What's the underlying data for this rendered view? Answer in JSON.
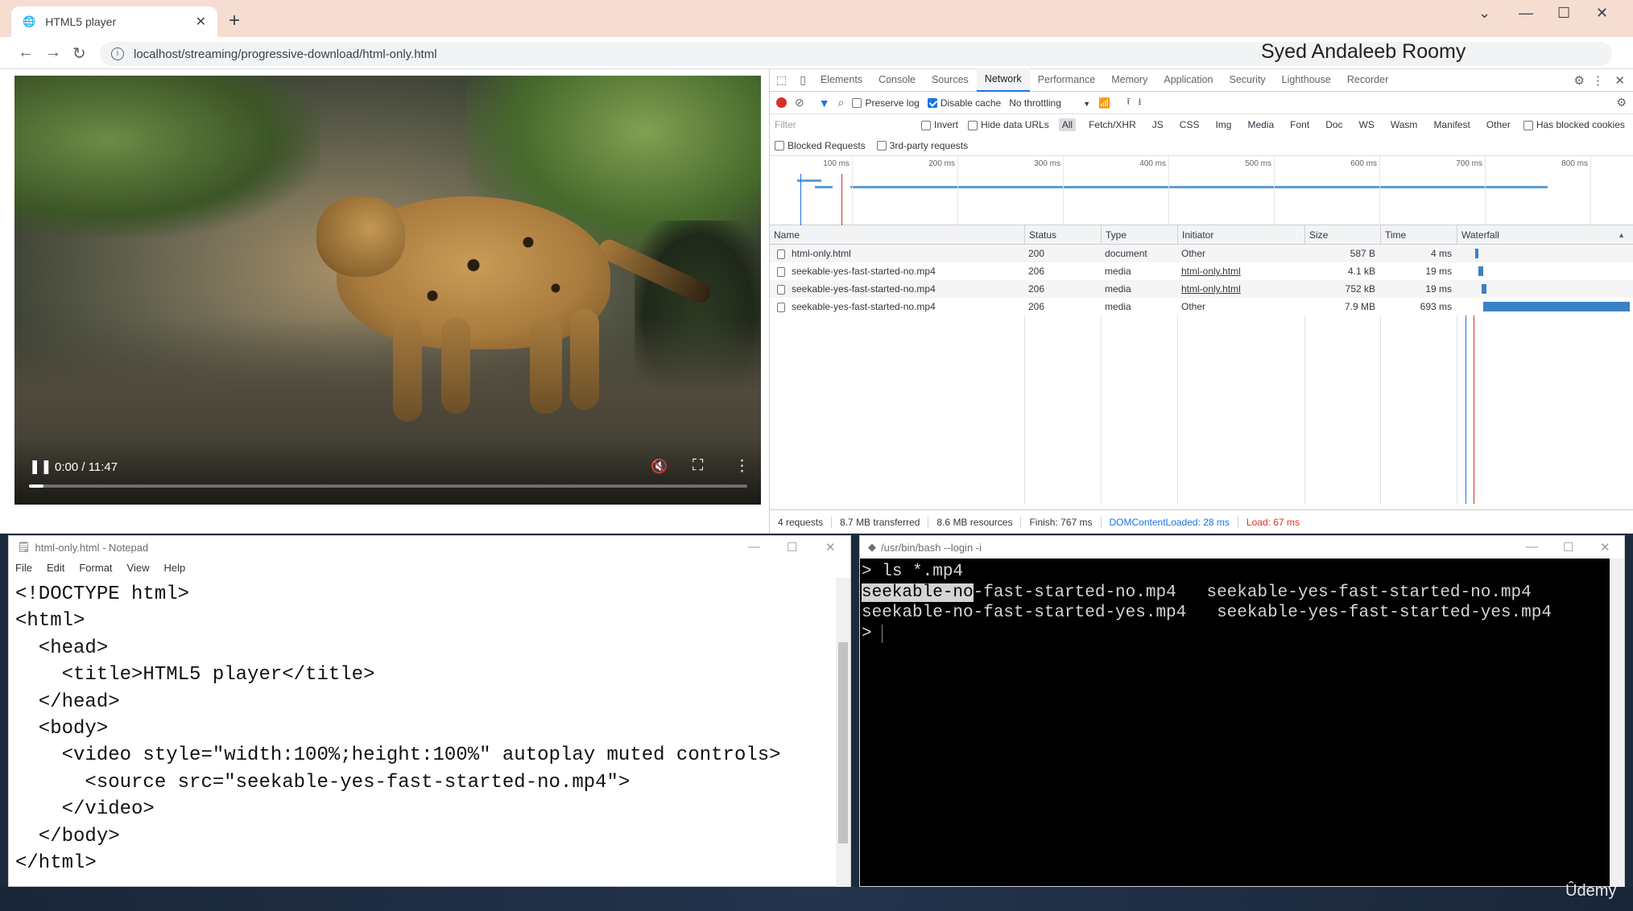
{
  "browser": {
    "tab_title": "HTML5 player",
    "url": "localhost/streaming/progressive-download/html-only.html",
    "watermark": "Syed Andaleeb Roomy"
  },
  "video": {
    "time": "0:00 / 11:47",
    "progress": 0.02
  },
  "devtools": {
    "tabs": [
      "Elements",
      "Console",
      "Sources",
      "Network",
      "Performance",
      "Memory",
      "Application",
      "Security",
      "Lighthouse",
      "Recorder"
    ],
    "active_tab": "Network",
    "toolbar": {
      "preserve_log": "Preserve log",
      "disable_cache": "Disable cache",
      "throttling": "No throttling"
    },
    "filter": {
      "placeholder": "Filter",
      "invert": "Invert",
      "hide_data_urls": "Hide data URLs",
      "types": [
        "All",
        "Fetch/XHR",
        "JS",
        "CSS",
        "Img",
        "Media",
        "Font",
        "Doc",
        "WS",
        "Wasm",
        "Manifest",
        "Other"
      ],
      "has_blocked_cookies": "Has blocked cookies",
      "blocked_requests": "Blocked Requests",
      "third_party": "3rd-party requests"
    },
    "overview_ticks": [
      "100 ms",
      "200 ms",
      "300 ms",
      "400 ms",
      "500 ms",
      "600 ms",
      "700 ms",
      "800 ms"
    ],
    "columns": {
      "name": "Name",
      "status": "Status",
      "type": "Type",
      "initiator": "Initiator",
      "size": "Size",
      "time": "Time",
      "waterfall": "Waterfall"
    },
    "requests": [
      {
        "name": "html-only.html",
        "status": "200",
        "type": "document",
        "initiator": "Other",
        "size": "587 B",
        "time": "4 ms"
      },
      {
        "name": "seekable-yes-fast-started-no.mp4",
        "status": "206",
        "type": "media",
        "initiator": "html-only.html",
        "size": "4.1 kB",
        "time": "19 ms"
      },
      {
        "name": "seekable-yes-fast-started-no.mp4",
        "status": "206",
        "type": "media",
        "initiator": "html-only.html",
        "size": "752 kB",
        "time": "19 ms"
      },
      {
        "name": "seekable-yes-fast-started-no.mp4",
        "status": "206",
        "type": "media",
        "initiator": "Other",
        "size": "7.9 MB",
        "time": "693 ms"
      }
    ],
    "summary": {
      "requests": "4 requests",
      "transferred": "8.7 MB transferred",
      "resources": "8.6 MB resources",
      "finish": "Finish: 767 ms",
      "dom": "DOMContentLoaded: 28 ms",
      "load": "Load: 67 ms"
    },
    "colors": {
      "dom": "#1a73e8",
      "load": "#d93025",
      "accent": "#1a73e8"
    }
  },
  "notepad": {
    "title": "html-only.html - Notepad",
    "menu": [
      "File",
      "Edit",
      "Format",
      "View",
      "Help"
    ],
    "lines": [
      "<!DOCTYPE html>",
      "<html>",
      "  <head>",
      "    <title>HTML5 player</title>",
      "  </head>",
      "  <body>",
      "    <video style=\"width:100%;height:100%\" autoplay muted controls>",
      "      <source src=\"seekable-yes-fast-started-no.mp4\">",
      "    </video>",
      "  </body>",
      "</html>"
    ]
  },
  "terminal": {
    "title": "/usr/bin/bash --login -i",
    "prompt": ">",
    "command": " ls *.mp4",
    "selected": "seekable-no",
    "line1_rest": "-fast-started-no.mp4   seekable-yes-fast-started-no.mp4",
    "line2": "seekable-no-fast-started-yes.mp4   seekable-yes-fast-started-yes.mp4",
    "line3": "> "
  },
  "brand": "Ûdemy"
}
